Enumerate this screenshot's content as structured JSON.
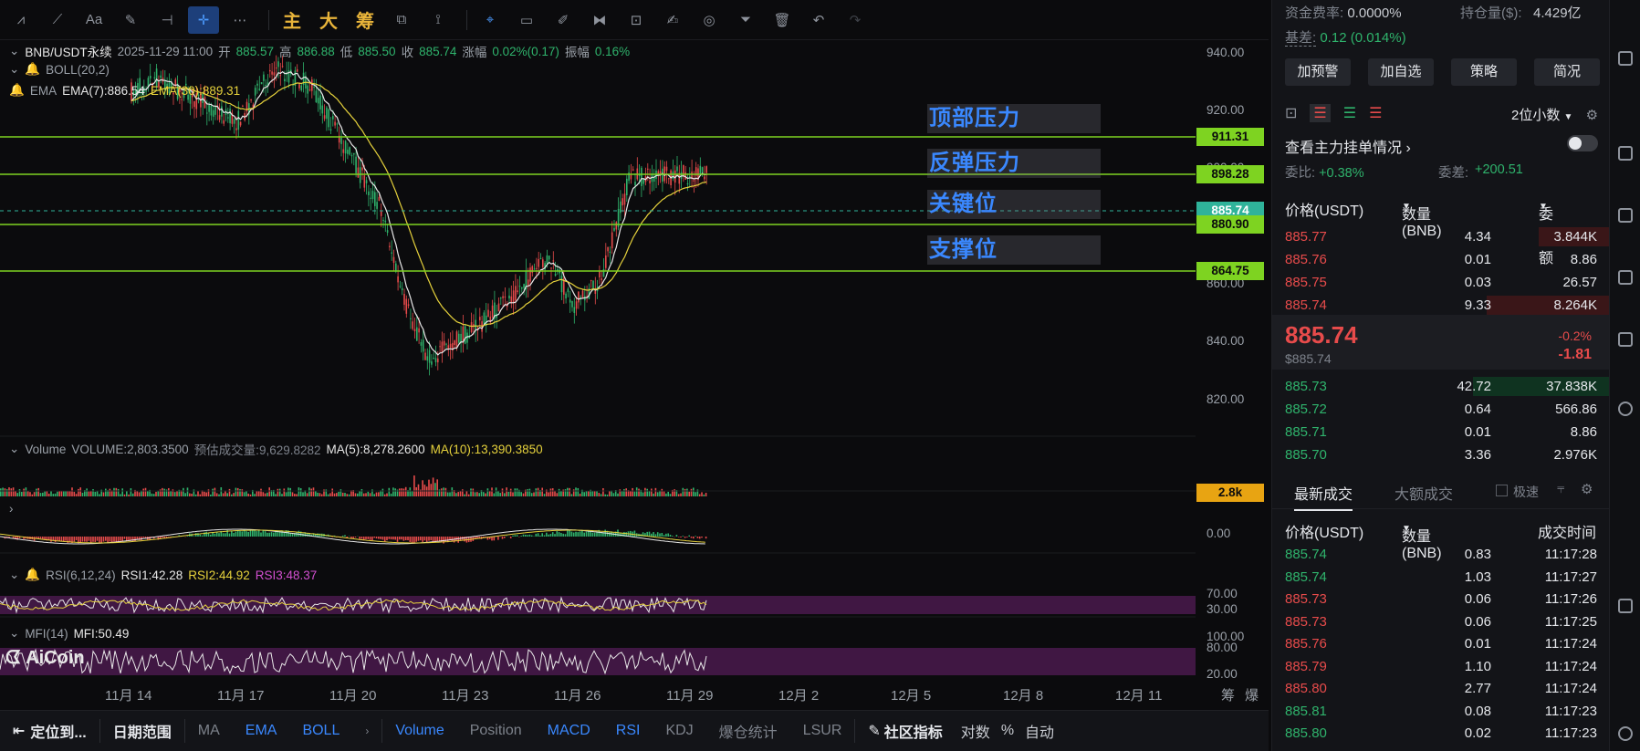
{
  "toolbar": {
    "icons": [
      "indicator-icon",
      "line-icon",
      "text-icon",
      "pen-icon",
      "horizontal-line-icon",
      "crosshair-icon",
      "more-icon"
    ],
    "main": "主",
    "big": "大",
    "chip": "筹"
  },
  "legend": {
    "pair": "BNB/USDT永续",
    "time": "2025-11-29 11:00",
    "open_label": "开",
    "open": "885.57",
    "high_label": "高",
    "high": "886.88",
    "low_label": "低",
    "low": "885.50",
    "close_label": "收",
    "close": "885.74",
    "change_label": "涨幅",
    "change": "0.02%(0.17)",
    "amp_label": "振幅",
    "amp": "0.16%",
    "boll": "BOLL(20,2)",
    "ema_label": "EMA",
    "ema7": "EMA(7):886.54",
    "ema30": "EMA(30):889.31"
  },
  "price_axis": [
    "940.00",
    "920.00",
    "900.00",
    "880.00",
    "860.00",
    "840.00",
    "820.00"
  ],
  "price_tags": [
    {
      "value": "911.31",
      "color": "#7ed321"
    },
    {
      "value": "898.28",
      "color": "#7ed321"
    },
    {
      "value": "885.74",
      "color": "#2fb39a"
    },
    {
      "value": "880.90",
      "color": "#7ed321"
    },
    {
      "value": "864.75",
      "color": "#7ed321"
    }
  ],
  "annotations": [
    "顶部压力",
    "反弹压力",
    "关键位",
    "支撑位"
  ],
  "volume": {
    "title": "Volume",
    "value": "VOLUME:2,803.3500",
    "est": "预估成交量:9,629.8282",
    "ma5": "MA(5):8,278.2600",
    "ma10": "MA(10):13,390.3850",
    "tag": "2.8k"
  },
  "macd_axis": "0.00",
  "rsi": {
    "title": "RSI(6,12,24)",
    "rsi1": "RSI1:42.28",
    "rsi2": "RSI2:44.92",
    "rsi3": "RSI3:48.37",
    "axis70": "70.00",
    "axis30": "30.00"
  },
  "mfi": {
    "title": "MFI(14)",
    "value": "MFI:50.49",
    "axis100": "100.00",
    "axis80": "80.00",
    "axis20": "20.00"
  },
  "logo": "AiCoin",
  "dates": [
    "11月 14",
    "11月 17",
    "11月 20",
    "11月 23",
    "11月 26",
    "11月 29",
    "12月 2",
    "12月 5",
    "12月 8",
    "12月 11"
  ],
  "date_right": [
    "筹",
    "爆"
  ],
  "bottom_bar": {
    "locate": "定位到...",
    "range": "日期范围",
    "items": [
      "MA",
      "EMA",
      "BOLL"
    ],
    "sub_items": [
      "Volume",
      "Position",
      "MACD",
      "RSI",
      "KDJ",
      "爆仓统计",
      "LSUR"
    ],
    "community": "社区指标",
    "log": "对数",
    "pct": "%",
    "auto": "自动"
  },
  "right_panel": {
    "funding_label": "资金费率:",
    "funding": "0.0000%",
    "oi_label": "持仓量($):",
    "oi": "4.429亿",
    "basis_label": "基差:",
    "basis": "0.12 (0.014%)",
    "buttons": [
      "加预警",
      "加自选",
      "策略",
      "简况"
    ],
    "decimals": "2位小数",
    "orders_link": "查看主力挂单情况",
    "ratio_label": "委比:",
    "ratio": "+0.38%",
    "diff_label": "委差:",
    "diff": "+200.51",
    "headers": [
      "价格(USDT)",
      "数量 (BNB)",
      "委托额"
    ],
    "asks": [
      [
        "885.77",
        "4.34",
        "3.844K"
      ],
      [
        "885.76",
        "0.01",
        "8.86"
      ],
      [
        "885.75",
        "0.03",
        "26.57"
      ],
      [
        "885.74",
        "9.33",
        "8.264K"
      ]
    ],
    "last_price": "885.74",
    "last_usd": "$885.74",
    "last_pct": "-0.2%",
    "last_change": "-1.81",
    "bids": [
      [
        "885.73",
        "42.72",
        "37.838K"
      ],
      [
        "885.72",
        "0.64",
        "566.86"
      ],
      [
        "885.71",
        "0.01",
        "8.86"
      ],
      [
        "885.70",
        "3.36",
        "2.976K"
      ]
    ],
    "trade_tabs": [
      "最新成交",
      "大额成交"
    ],
    "fast": "极速",
    "trade_headers": [
      "价格(USDT)",
      "数量(BNB)",
      "成交时间"
    ],
    "trades": [
      [
        "885.74",
        "0.83",
        "11:17:28",
        "buy"
      ],
      [
        "885.74",
        "1.03",
        "11:17:27",
        "buy"
      ],
      [
        "885.73",
        "0.06",
        "11:17:26",
        "sell"
      ],
      [
        "885.73",
        "0.06",
        "11:17:25",
        "sell"
      ],
      [
        "885.76",
        "0.01",
        "11:17:24",
        "sell"
      ],
      [
        "885.79",
        "1.10",
        "11:17:24",
        "sell"
      ],
      [
        "885.80",
        "2.77",
        "11:17:24",
        "sell"
      ],
      [
        "885.81",
        "0.08",
        "11:17:23",
        "buy"
      ],
      [
        "885.80",
        "0.02",
        "11:17:23",
        "buy"
      ]
    ]
  },
  "colors": {
    "up": "#2fb36c",
    "down": "#e74b4b",
    "accent": "#3a88ff",
    "level": "#7ed321"
  }
}
